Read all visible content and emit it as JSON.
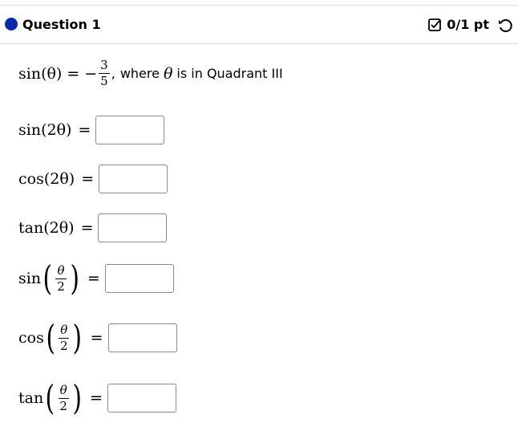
{
  "question": {
    "title": "Question 1",
    "score": "0/1 pt"
  },
  "prompt": {
    "lhs": "sin(θ)",
    "equals": "=",
    "minus": "−",
    "numerator": "3",
    "denominator": "5",
    "after_comma": ",",
    "text_where": "where",
    "theta": "θ",
    "text_rest": "is in Quadrant III"
  },
  "rows": [
    {
      "fn": "sin",
      "arg": "(2θ)",
      "eq": "="
    },
    {
      "fn": "cos",
      "arg": "(2θ)",
      "eq": "="
    },
    {
      "fn": "tan",
      "arg": "(2θ)",
      "eq": "="
    },
    {
      "fn": "sin",
      "half_num": "θ",
      "half_den": "2",
      "eq": "="
    },
    {
      "fn": "cos",
      "half_num": "θ",
      "half_den": "2",
      "eq": "="
    },
    {
      "fn": "tan",
      "half_num": "θ",
      "half_den": "2",
      "eq": "="
    }
  ],
  "colors": {
    "dot": "#0c2aa8"
  }
}
